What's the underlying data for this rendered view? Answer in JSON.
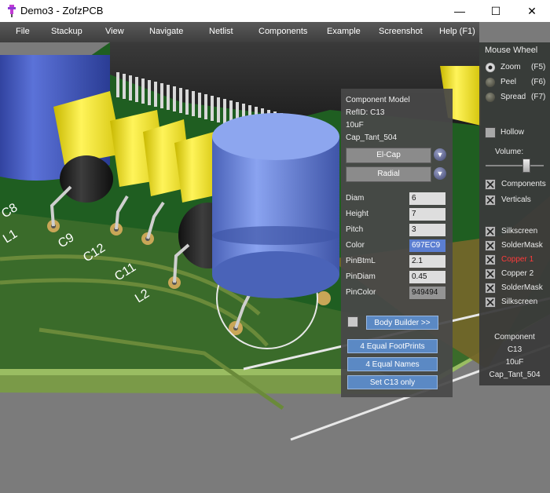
{
  "window": {
    "title": "Demo3 - ZofzPCB",
    "minimize": "—",
    "maximize": "☐",
    "close": "✕"
  },
  "menu": [
    "File",
    "Stackup",
    "View",
    "Navigate",
    "Netlist",
    "Components",
    "Example",
    "Screenshot",
    "Help (F1)"
  ],
  "pcb_labels": [
    "C8",
    "L1",
    "C9",
    "C12",
    "C11",
    "L2"
  ],
  "component_model": {
    "title": "Component Model",
    "refid": "RefID: C13",
    "value": "10uF",
    "footprint": "Cap_Tant_504",
    "body_type": "El-Cap",
    "mount_type": "Radial",
    "params": [
      {
        "label": "Diam",
        "value": "6"
      },
      {
        "label": "Height",
        "value": "7"
      },
      {
        "label": "Pitch",
        "value": "3"
      },
      {
        "label": "Color",
        "value": "697EC9"
      },
      {
        "label": "PinBtmL",
        "value": "2.1"
      },
      {
        "label": "PinDiam",
        "value": "0.45"
      },
      {
        "label": "PinColor",
        "value": "949494"
      }
    ],
    "color_swatch": "#5b7ed1",
    "body_builder": "Body Builder >>",
    "btn_footprints": "4 Equal FootPrints",
    "btn_names": "4 Equal Names",
    "btn_set": "Set C13 only"
  },
  "mouse_wheel": {
    "title": "Mouse Wheel",
    "options": [
      {
        "label": "Zoom",
        "key": "(F5)",
        "selected": true
      },
      {
        "label": "Peel",
        "key": "(F6)",
        "selected": false
      },
      {
        "label": "Spread",
        "key": "(F7)",
        "selected": false
      }
    ]
  },
  "hollow_label": "Hollow",
  "volume_label": "Volume:",
  "volume_level": 0.82,
  "show": [
    {
      "label": "Components",
      "checked": true
    },
    {
      "label": "Verticals",
      "checked": true
    }
  ],
  "layers": [
    {
      "label": "Silkscreen",
      "checked": true,
      "color": "#e8e8e8"
    },
    {
      "label": "SolderMask",
      "checked": true,
      "color": "#e8e8e8"
    },
    {
      "label": "Copper 1",
      "checked": true,
      "color": "#ff3b3b"
    },
    {
      "label": "Copper 2",
      "checked": true,
      "color": "#e8e8e8"
    },
    {
      "label": "SolderMask",
      "checked": true,
      "color": "#e8e8e8"
    },
    {
      "label": "Silkscreen",
      "checked": true,
      "color": "#e8e8e8"
    }
  ],
  "component_info": {
    "title": "Component",
    "refid": "C13",
    "value": "10uF",
    "footprint": "Cap_Tant_504"
  }
}
